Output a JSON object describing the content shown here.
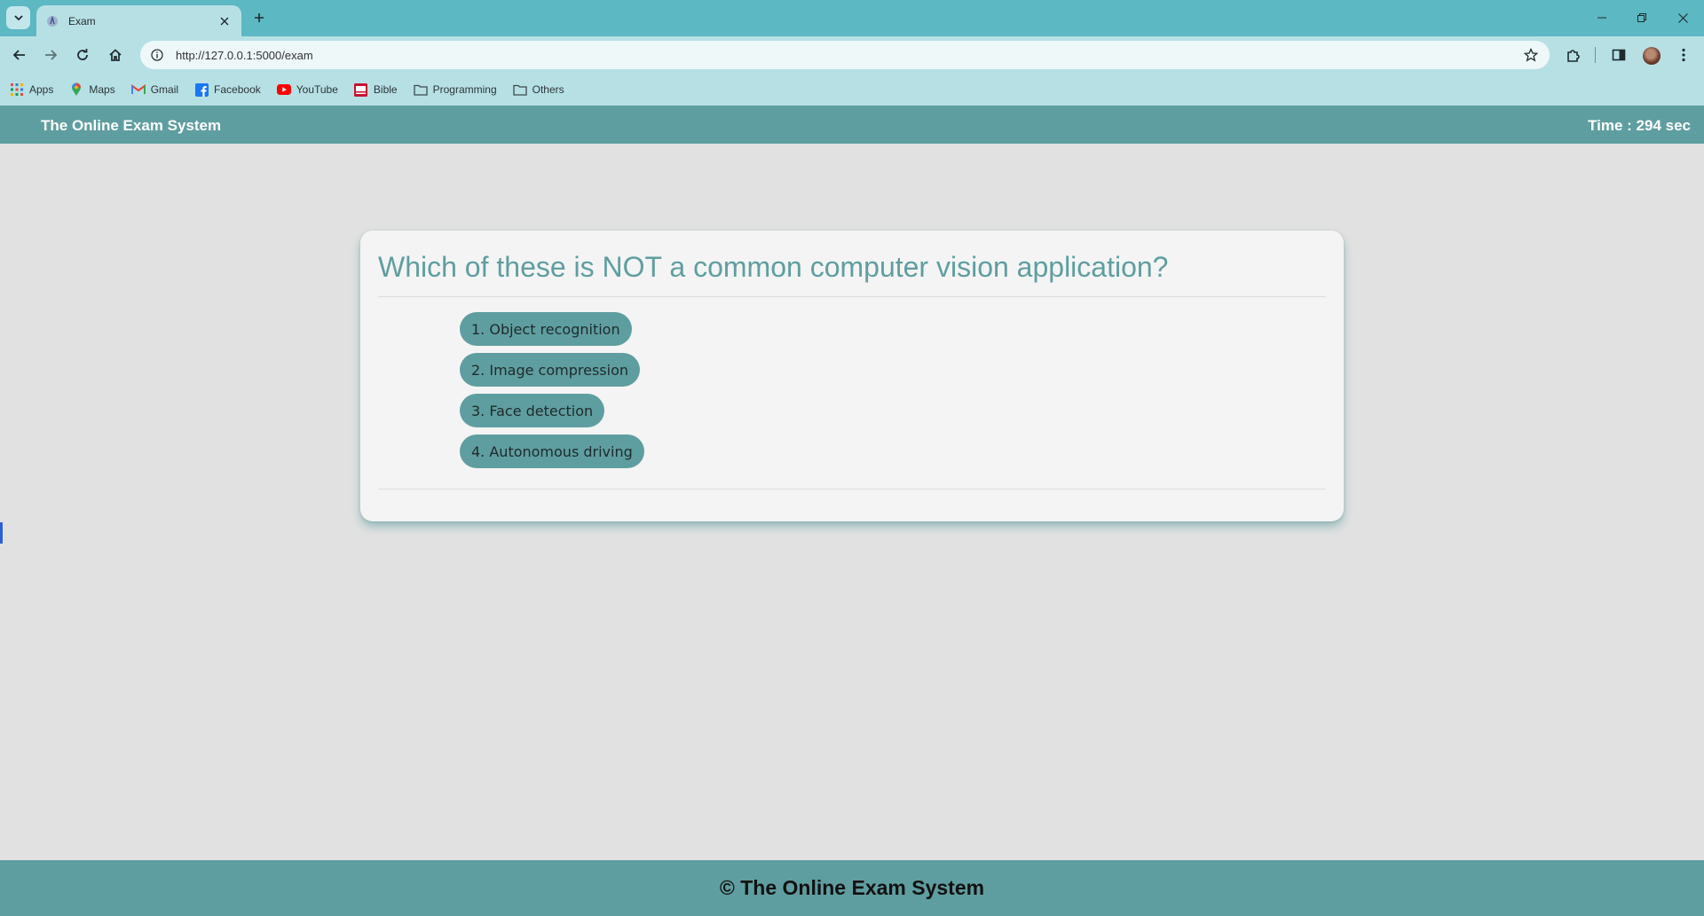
{
  "browser": {
    "tab_title": "Exam",
    "url": "http://127.0.0.1:5000/exam",
    "bookmarks": [
      {
        "label": "Apps",
        "icon": "apps-grid-icon"
      },
      {
        "label": "Maps",
        "icon": "maps-pin-icon"
      },
      {
        "label": "Gmail",
        "icon": "gmail-icon"
      },
      {
        "label": "Facebook",
        "icon": "facebook-icon"
      },
      {
        "label": "YouTube",
        "icon": "youtube-icon"
      },
      {
        "label": "Bible",
        "icon": "bible-icon"
      },
      {
        "label": "Programming",
        "icon": "folder-icon"
      },
      {
        "label": "Others",
        "icon": "folder-icon"
      }
    ]
  },
  "header": {
    "brand": "The Online Exam System",
    "timer": "Time : 294 sec"
  },
  "exam": {
    "question": "Which of these is NOT a common computer vision application?",
    "options": [
      "1. Object recognition",
      "2. Image compression",
      "3. Face detection",
      "4. Autonomous driving"
    ]
  },
  "footer": {
    "text": "© The Online Exam System"
  },
  "colors": {
    "accent": "#5f9ea0",
    "chrome": "#5cb8c2",
    "page_bg": "#e1e1e1"
  }
}
